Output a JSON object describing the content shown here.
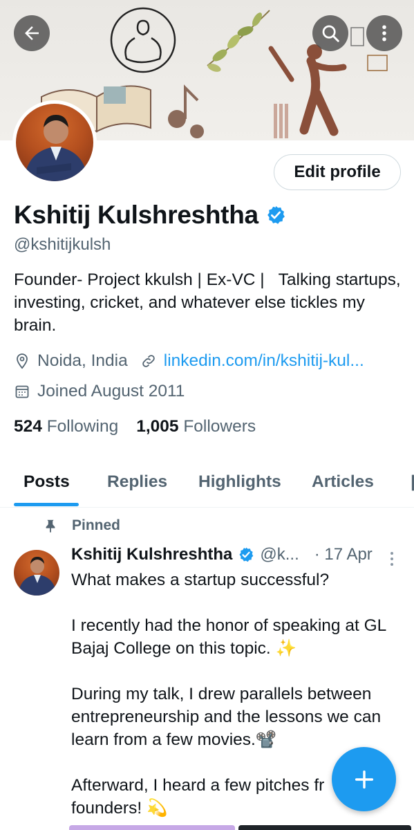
{
  "profile": {
    "display_name": "Kshitij Kulshreshtha",
    "handle": "@kshitijkulsh",
    "bio": "Founder- Project kkulsh | Ex-VC |   Talking startups, investing, cricket, and whatever else tickles my brain.",
    "location": "Noida, India",
    "link": "linkedin.com/in/kshitij-kul...",
    "joined": "Joined August 2011",
    "following_count": "524",
    "following_label": "Following",
    "followers_count": "1,005",
    "followers_label": "Followers",
    "edit_label": "Edit profile"
  },
  "tabs": [
    {
      "label": "Posts",
      "active": true
    },
    {
      "label": "Replies",
      "active": false
    },
    {
      "label": "Highlights",
      "active": false
    },
    {
      "label": "Articles",
      "active": false
    }
  ],
  "post": {
    "pinned_label": "Pinned",
    "author": "Kshitij Kulshreshtha",
    "handle": "@k...",
    "date": "· 17 Apr",
    "paragraphs": [
      "What makes a startup successful?",
      "I recently had the honor of speaking at GL Bajaj College on this topic. ✨",
      "During my talk, I drew parallels between entrepreneurship and the lessons we can learn from a few movies.📽️",
      "Afterward, I heard a few pitches fr\nfounders! 💫"
    ]
  },
  "icons": {
    "back": "arrow-left-icon",
    "search": "search-icon",
    "more": "more-vertical-icon",
    "verified": "verified-badge-icon",
    "location": "location-pin-icon",
    "link": "link-icon",
    "calendar": "calendar-icon",
    "pin": "pin-icon",
    "compose": "plus-icon"
  },
  "colors": {
    "accent": "#1d9bf0",
    "secondary_text": "#536471",
    "primary_text": "#0f1419"
  }
}
